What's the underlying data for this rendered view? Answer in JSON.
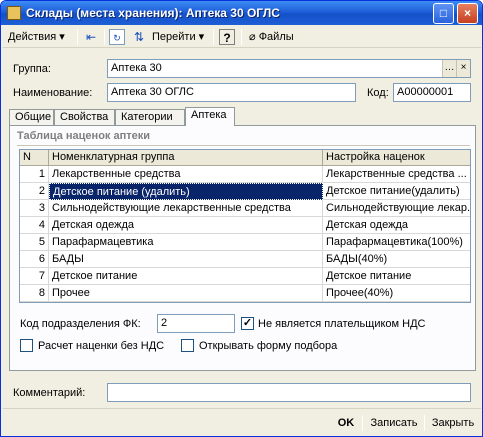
{
  "window": {
    "title": "Склады (места хранения): Аптека 30 ОГЛС"
  },
  "toolbar": {
    "actions_label": "Действия",
    "goto_label": "Перейти",
    "help_label": "?",
    "files_label": "Файлы"
  },
  "form": {
    "group_label": "Группа:",
    "group_value": "Аптека 30",
    "name_label": "Наименование:",
    "name_value": "Аптека 30 ОГЛС",
    "code_label": "Код:",
    "code_value": "А00000001"
  },
  "tabs": [
    {
      "label": "Общие"
    },
    {
      "label": "Свойства"
    },
    {
      "label": "Категории"
    },
    {
      "label": "Аптека"
    }
  ],
  "pharmacy": {
    "section_title": "Таблица наценок аптеки",
    "columns": [
      "N",
      "Номенклатурная группа",
      "Настройка наценок"
    ],
    "rows": [
      {
        "n": "1",
        "group": "Лекарственные средства",
        "markup": "Лекарственные средства ..."
      },
      {
        "n": "2",
        "group": "Детское питание (удалить)",
        "markup": "Детское питание(удалить)"
      },
      {
        "n": "3",
        "group": "Сильнодействующие лекарственные средства",
        "markup": "Сильнодействующие лекар..."
      },
      {
        "n": "4",
        "group": "Детская одежда",
        "markup": "Детская одежда"
      },
      {
        "n": "5",
        "group": "Парафармацевтика",
        "markup": "Парафармацевтика(100%)"
      },
      {
        "n": "6",
        "group": "БАДЫ",
        "markup": "БАДЫ(40%)"
      },
      {
        "n": "7",
        "group": "Детское питание",
        "markup": "Детское питание"
      },
      {
        "n": "8",
        "group": "Прочее",
        "markup": "Прочее(40%)"
      }
    ],
    "fk_label": "Код подразделения ФК:",
    "fk_value": "2",
    "not_vat_label": "Не является плательщиком НДС",
    "not_vat_checked": true,
    "markup_no_vat_label": "Расчет наценки без НДС",
    "markup_no_vat_checked": false,
    "open_selection_label": "Открывать форму подбора",
    "open_selection_checked": false
  },
  "comment": {
    "label": "Комментарий:",
    "value": ""
  },
  "buttons": {
    "ok": "OK",
    "save": "Записать",
    "close": "Закрыть"
  }
}
